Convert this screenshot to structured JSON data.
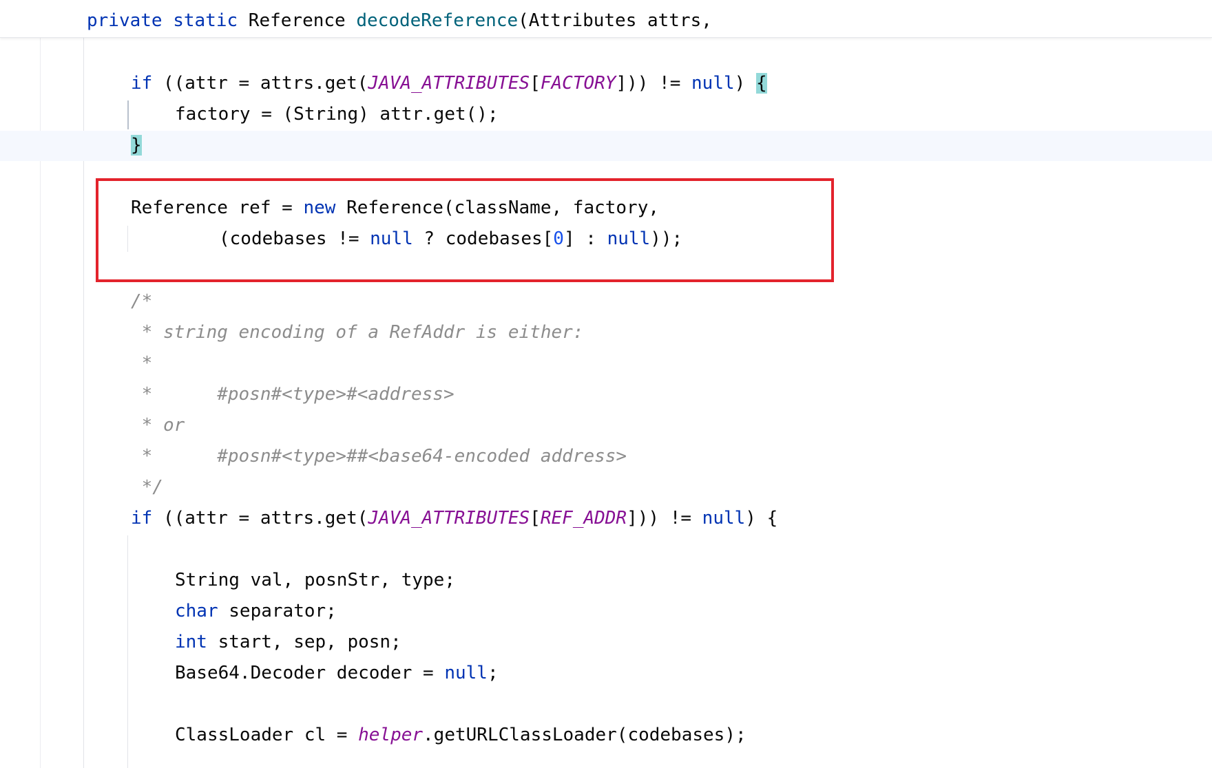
{
  "editor": {
    "header_line": [
      "private",
      " ",
      "static",
      " Reference ",
      "decodeReference",
      "(Attributes attrs,"
    ],
    "lines": {
      "l1": [
        "if",
        " ((attr = attrs.get(",
        "JAVA_ATTRIBUTES",
        "[",
        "FACTORY",
        "])) != ",
        "null",
        ") ",
        "{"
      ],
      "l2": "factory = (String) attr.get();",
      "l3": "}",
      "l4": [
        "Reference ref = ",
        "new",
        " Reference(className, factory,"
      ],
      "l5": [
        "(codebases != ",
        "null",
        " ? codebases[",
        "0",
        "] : ",
        "null",
        "));"
      ],
      "c1": "/*",
      "c2": " * string encoding of a RefAddr is either:",
      "c3": " *",
      "c4": " *      #posn#<type>#<address>",
      "c5": " * or",
      "c6": " *      #posn#<type>##<base64-encoded address>",
      "c7": " */",
      "l6": [
        "if",
        " ((attr = attrs.get(",
        "JAVA_ATTRIBUTES",
        "[",
        "REF_ADDR",
        "])) != ",
        "null",
        ") {"
      ],
      "l7": "String val, posnStr, type;",
      "l8": [
        "char",
        " separator;"
      ],
      "l9": [
        "int",
        " start, sep, posn;"
      ],
      "l10": [
        "Base64.Decoder decoder = ",
        "null",
        ";"
      ],
      "l11": [
        "ClassLoader cl = ",
        "helper",
        ".getURLClassLoader(codebases);"
      ]
    }
  },
  "colors": {
    "keyword": "#0033b3",
    "method_declaration": "#00627a",
    "static_field": "#871094",
    "number": "#1750eb",
    "comment": "#8c8c8c",
    "highlight_box": "#e3232c",
    "brace_match": "#93d9d9"
  }
}
